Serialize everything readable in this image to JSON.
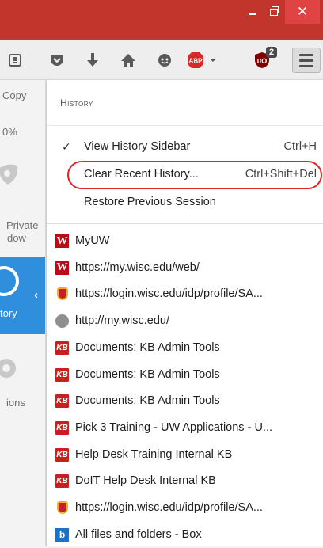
{
  "titlebar": {
    "minimize": "minimize",
    "maximize": "maximize",
    "close_glyph": "✕"
  },
  "toolbar": {
    "icons": [
      "reading-list-icon",
      "pocket-icon",
      "download-icon",
      "home-icon",
      "chat-icon",
      "adblock-plus-icon",
      "ublock-icon"
    ],
    "abp_label": "ABP",
    "ublock_badge": "2"
  },
  "left_panel": {
    "copy_label": "Copy",
    "zoom_value": "0%",
    "private_line1": "Private",
    "private_line2": "dow",
    "history_label": "tory",
    "options_label": "ions",
    "history_arrow": "‹"
  },
  "history_panel": {
    "header": "History",
    "commands": [
      {
        "label": "View History Sidebar",
        "shortcut": "Ctrl+H",
        "checked": "✓"
      },
      {
        "label": "Clear Recent History...",
        "shortcut": "Ctrl+Shift+Del",
        "checked": ""
      },
      {
        "label": "Restore Previous Session",
        "shortcut": "",
        "checked": ""
      }
    ],
    "entries": [
      {
        "title": "MyUW",
        "icon": "w-icon",
        "fav": "W"
      },
      {
        "title": "https://my.wisc.edu/web/",
        "icon": "w-icon",
        "fav": "W"
      },
      {
        "title": "https://login.wisc.edu/idp/profile/SA...",
        "icon": "uw-crest-icon",
        "fav": ""
      },
      {
        "title": "http://my.wisc.edu/",
        "icon": "globe-icon",
        "fav": ""
      },
      {
        "title": "Documents: KB Admin Tools",
        "icon": "kb-icon",
        "fav": "KB"
      },
      {
        "title": "Documents: KB Admin Tools",
        "icon": "kb-icon",
        "fav": "KB"
      },
      {
        "title": "Documents: KB Admin Tools",
        "icon": "kb-icon",
        "fav": "KB"
      },
      {
        "title": "Pick 3 Training - UW Applications - U...",
        "icon": "kb-icon",
        "fav": "KB"
      },
      {
        "title": "Help Desk Training Internal KB",
        "icon": "kb-icon",
        "fav": "KB"
      },
      {
        "title": "DoIT Help Desk Internal KB",
        "icon": "kb-icon",
        "fav": "KB"
      },
      {
        "title": "https://login.wisc.edu/idp/profile/SA...",
        "icon": "uw-crest-icon",
        "fav": ""
      },
      {
        "title": "All files and folders - Box",
        "icon": "box-icon",
        "fav": "b"
      }
    ]
  },
  "colors": {
    "titlebar": "#c1352d",
    "highlight": "#e02424",
    "history_tab": "#2f8fdc"
  }
}
